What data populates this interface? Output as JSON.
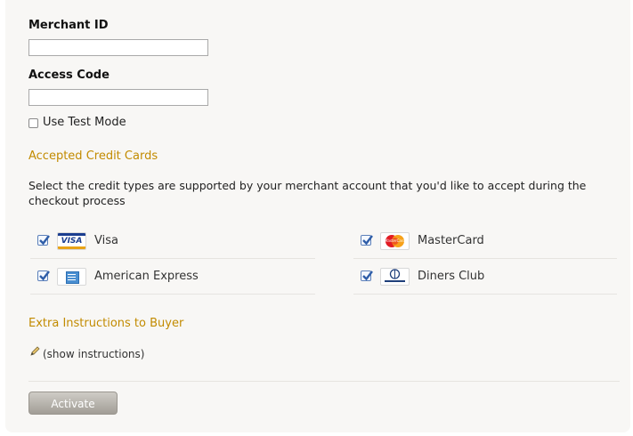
{
  "form": {
    "merchant_id_label": "Merchant ID",
    "merchant_id_value": "",
    "access_code_label": "Access Code",
    "access_code_value": "",
    "test_mode_label": "Use Test Mode"
  },
  "cards_section": {
    "heading": "Accepted Credit Cards",
    "description": "Select the credit types are supported by your merchant account that you'd like to accept during the checkout process",
    "cards": [
      {
        "name": "Visa",
        "logo": "visa-logo",
        "checked": true
      },
      {
        "name": "MasterCard",
        "logo": "mastercard-logo",
        "checked": true
      },
      {
        "name": "American Express",
        "logo": "amex-logo",
        "checked": true
      },
      {
        "name": "Diners Club",
        "logo": "diners-club-logo",
        "checked": true
      }
    ],
    "visa_logo_text": "VISA",
    "mastercard_logo_text": "MasterCard"
  },
  "instructions_section": {
    "heading": "Extra Instructions to Buyer",
    "show_link": "(show instructions)",
    "icon": "pencil-icon"
  },
  "actions": {
    "activate_label": "Activate"
  },
  "colors": {
    "heading_accent": "#c28b00",
    "panel_bg": "#f8f7f5",
    "check_blue": "#2f5ea8"
  }
}
